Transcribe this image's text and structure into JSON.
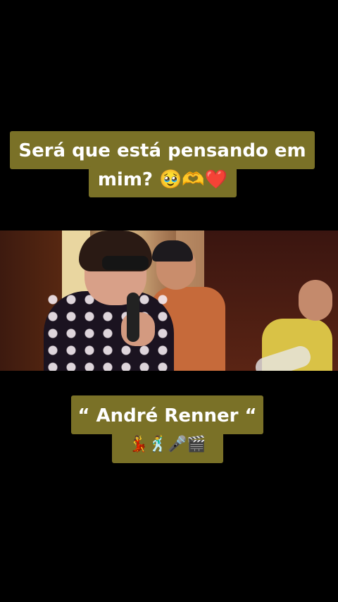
{
  "captions": {
    "top_line1": "Será que está pensando em",
    "top_line2": "mim? 🥹🫶❤️",
    "bottom_line1": "“ André Renner “",
    "bottom_line2": "💃🕺🎤🎬"
  },
  "colors": {
    "background": "#000000",
    "caption_bg": "#7a7127",
    "caption_text": "#ffffff"
  }
}
